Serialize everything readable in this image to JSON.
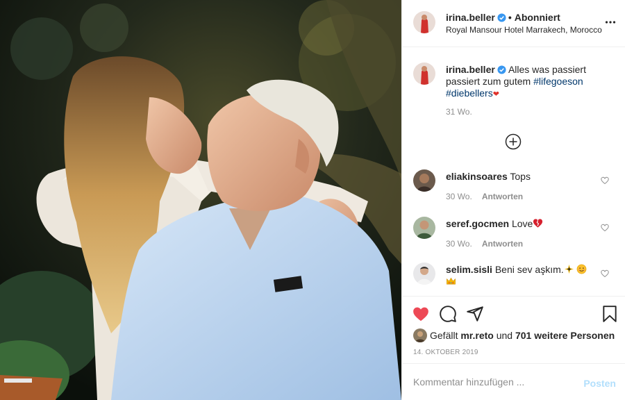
{
  "post": {
    "author": {
      "username": "irina.beller",
      "verified": true,
      "follow_status": "Abonniert",
      "location": "Royal Mansour Hotel Marrakech, Morocco"
    },
    "caption": {
      "username": "irina.beller",
      "text": "Alles was passiert passiert zum gutem",
      "hashtag_1": "#lifegoeson",
      "hashtag_2": "#diebellers",
      "emoji": "❤",
      "time": "31 Wo."
    },
    "load_more_icon": "plus-circle-icon",
    "comments": [
      {
        "username": "eliakinsoares",
        "text": "Tops",
        "time": "30 Wo.",
        "reply": "Antworten"
      },
      {
        "username": "seref.gocmen",
        "text": "Love",
        "emoji": "broken-heart",
        "time": "30 Wo.",
        "reply": "Antworten"
      },
      {
        "username": "selim.sisli",
        "text": "Beni sev aşkım.",
        "emoji": "sparkle-smile-crown",
        "reply": ""
      }
    ],
    "actions": {
      "liked": true,
      "icons": [
        "heart-icon",
        "comment-icon",
        "share-icon",
        "bookmark-icon"
      ]
    },
    "likes": {
      "prefix": "Gefällt",
      "user": "mr.reto",
      "connector": "und",
      "others": "701 weitere Personen"
    },
    "date": "14. OKTOBER 2019",
    "add_comment": {
      "placeholder": "Kommentar hinzufügen ...",
      "post_label": "Posten"
    }
  },
  "colors": {
    "like_red": "#ed4956",
    "hashtag_blue": "#00376b",
    "post_disabled": "#b2dffc",
    "verified_blue": "#3897f0",
    "muted": "#8e8e8e"
  }
}
